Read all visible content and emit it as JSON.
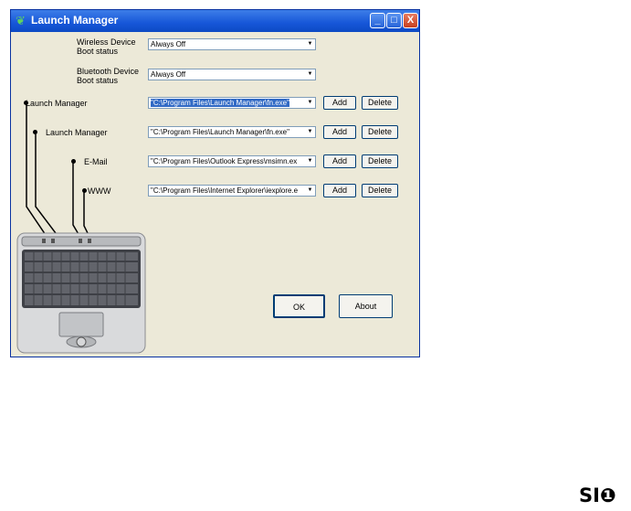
{
  "window": {
    "title": "Launch Manager",
    "minimize_label": "_",
    "maximize_label": "□",
    "close_label": "X"
  },
  "wireless": {
    "label": "Wireless Device Boot status",
    "value": "Always Off"
  },
  "bluetooth": {
    "label": "Bluetooth Device Boot status",
    "value": "Always Off"
  },
  "keys": [
    {
      "label": "Launch Manager",
      "value": "\"C:\\Program Files\\Launch Manager\\fn.exe\"",
      "add": "Add",
      "delete": "Delete"
    },
    {
      "label": "Launch Manager",
      "value": "\"C:\\Program Files\\Launch Manager\\fn.exe\"",
      "add": "Add",
      "delete": "Delete"
    },
    {
      "label": "E-Mail",
      "value": "\"C:\\Program Files\\Outlook Express\\msimn.ex",
      "add": "Add",
      "delete": "Delete"
    },
    {
      "label": "WWW",
      "value": "\"C:\\Program Files\\Internet Explorer\\iexplore.e",
      "add": "Add",
      "delete": "Delete"
    }
  ],
  "ok_label": "OK",
  "about_label": "About",
  "dropdown_arrow": "▼",
  "page_logo": "SI❶",
  "icons": {
    "title": "launch-manager-app-icon",
    "dropdown": "chevron-down-icon"
  }
}
